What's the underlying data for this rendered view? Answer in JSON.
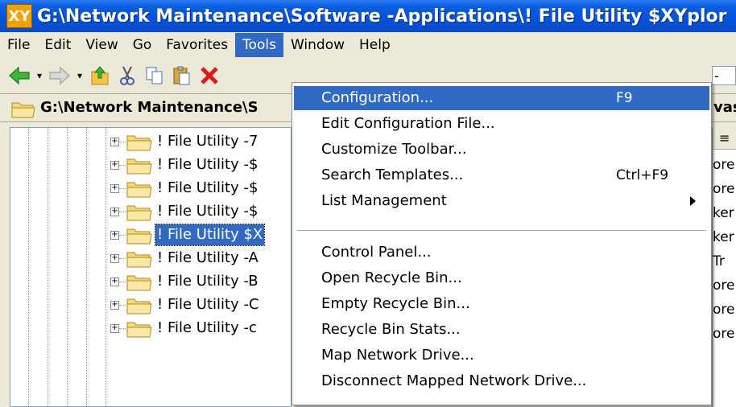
{
  "window": {
    "icon_text": "XY",
    "title": "G:\\Network Maintenance\\Software -Applications\\! File Utility $XYplor"
  },
  "menubar": {
    "items": [
      "File",
      "Edit",
      "View",
      "Go",
      "Favorites",
      "Tools",
      "Window",
      "Help"
    ],
    "active": "Tools"
  },
  "toolbar": {
    "buttons": [
      "back-arrow-icon",
      "forward-arrow-icon",
      "up-folder-icon",
      "cut-icon",
      "copy-icon",
      "paste-icon",
      "delete-icon"
    ],
    "address_value": "-Ap"
  },
  "breadcrumb": {
    "path": "G:\\Network Maintenance\\S",
    "right_text": "vas"
  },
  "tree": {
    "items": [
      "! File Utility -7",
      "! File Utility -$",
      "! File Utility -$",
      "! File Utility -$",
      "! File Utility $X",
      "! File Utility -A",
      "! File Utility -B",
      "! File Utility -C",
      "! File Utility -c"
    ],
    "selected_index": 4
  },
  "list": {
    "header": "≡",
    "cells": [
      "ore",
      "ore",
      "ker",
      "ker",
      "Tr",
      "ore",
      "ore",
      "ore"
    ]
  },
  "tools_menu": {
    "items": [
      {
        "label": "Configuration...",
        "shortcut": "F9",
        "highlight": true
      },
      {
        "label": "Edit Configuration File...",
        "shortcut": ""
      },
      {
        "label": "Customize Toolbar...",
        "shortcut": ""
      },
      {
        "label": "Search Templates...",
        "shortcut": "Ctrl+F9"
      },
      {
        "label": "List Management",
        "shortcut": "",
        "submenu": true
      },
      {
        "label": "Control Panel...",
        "shortcut": ""
      },
      {
        "label": "Open Recycle Bin...",
        "shortcut": ""
      },
      {
        "label": "Empty Recycle Bin...",
        "shortcut": ""
      },
      {
        "label": "Recycle Bin Stats...",
        "shortcut": ""
      },
      {
        "label": "Map Network Drive...",
        "shortcut": ""
      },
      {
        "label": "Disconnect Mapped Network Drive...",
        "shortcut": ""
      }
    ]
  },
  "colors": {
    "titlebar": "#0453d8",
    "highlight": "#316ac5",
    "chrome": "#ece9d8"
  }
}
